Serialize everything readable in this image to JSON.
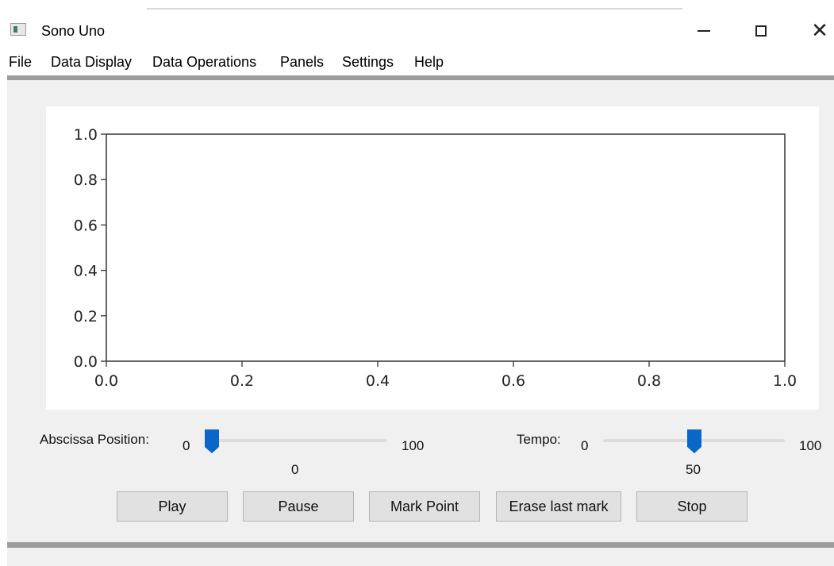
{
  "window": {
    "title": "Sono Uno",
    "icon": "app-icon"
  },
  "menu": [
    "File",
    "Data Display",
    "Data Operations",
    "Panels",
    "Settings",
    "Help"
  ],
  "chart_data": {
    "type": "line",
    "series": [],
    "xlim": [
      0.0,
      1.0
    ],
    "ylim": [
      0.0,
      1.0
    ],
    "xticks": [
      "0.0",
      "0.2",
      "0.4",
      "0.6",
      "0.8",
      "1.0"
    ],
    "yticks": [
      "0.0",
      "0.2",
      "0.4",
      "0.6",
      "0.8",
      "1.0"
    ],
    "grid": false
  },
  "abscissa": {
    "label": "Abscissa Position:",
    "min": "0",
    "max": "100",
    "value": 0,
    "value_label": "0"
  },
  "tempo": {
    "label": "Tempo:",
    "min": "0",
    "max": "100",
    "value": 50,
    "value_label": "50"
  },
  "buttons": {
    "play": "Play",
    "pause": "Pause",
    "mark": "Mark Point",
    "erase": "Erase last mark",
    "stop": "Stop"
  },
  "colors": {
    "slider_thumb": "#0a66c9",
    "separator": "#9c9c9c",
    "client_bg": "#f0f0f0"
  }
}
